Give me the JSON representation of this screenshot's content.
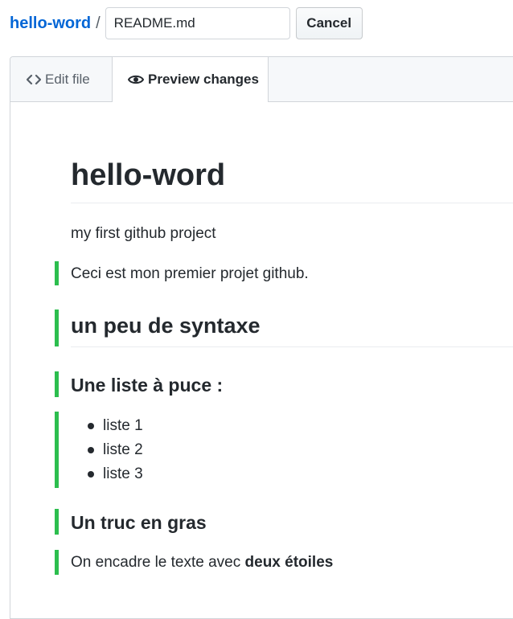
{
  "breadcrumb": {
    "repo_name": "hello-word",
    "separator": "/"
  },
  "filename_input": {
    "value": "README.md"
  },
  "cancel_label": "Cancel",
  "tabs": {
    "edit_label": "Edit file",
    "preview_label": "Preview changes",
    "active": "preview"
  },
  "preview": {
    "h1": "hello-word",
    "intro": "my first github project",
    "line_added": "Ceci est mon premier projet github.",
    "h2": "un peu de syntaxe",
    "h3_list": "Une liste à puce :",
    "list_items": [
      "liste 1",
      "liste 2",
      "liste 3"
    ],
    "h3_bold": "Un truc en gras",
    "bold_sentence_prefix": "On encadre le texte avec ",
    "bold_sentence_strong": "deux étoiles"
  },
  "colors": {
    "link": "#0366d6",
    "added_marker": "#2cbe4e",
    "text": "#24292e",
    "muted": "#586069"
  },
  "icons": {
    "edit_tab": "code-icon",
    "preview_tab": "eye-icon"
  }
}
